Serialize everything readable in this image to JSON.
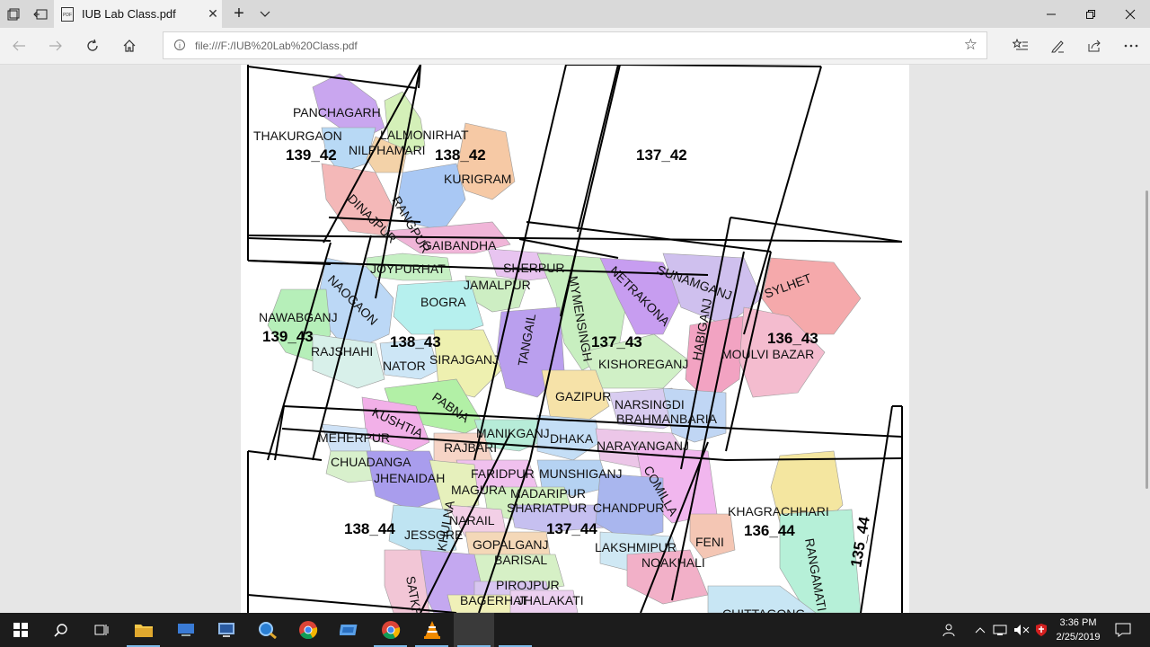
{
  "browser": {
    "tab_title": "IUB Lab Class.pdf",
    "url": "file:///F:/IUB%20Lab%20Class.pdf",
    "new_tab": "+",
    "close_tab": "✕",
    "pdf_icon": "PDF"
  },
  "map": {
    "districts": [
      {
        "name": "PANCHAGARH",
        "color": "#c9a6ef"
      },
      {
        "name": "THAKURGAON",
        "color": "#b8d9f5"
      },
      {
        "name": "LALMONIRHAT",
        "color": "#d4f0b8"
      },
      {
        "name": "NILPHAMARI",
        "color": "#f3d2a8"
      },
      {
        "name": "KURIGRAM",
        "color": "#f6c9a5"
      },
      {
        "name": "DINAJPUR",
        "color": "#f4b8b8"
      },
      {
        "name": "RANGPUR",
        "color": "#a9c8f4"
      },
      {
        "name": "GAIBANDHA",
        "color": "#f0b5d8"
      },
      {
        "name": "JOYPURHAT",
        "color": "#c6f0c4"
      },
      {
        "name": "NAOGAON",
        "color": "#bcd8f6"
      },
      {
        "name": "SHERPUR",
        "color": "#e8c4f0"
      },
      {
        "name": "JAMALPUR",
        "color": "#cdeec3"
      },
      {
        "name": "MYMENSINGH",
        "color": "#c8efc0"
      },
      {
        "name": "NETRAKONA",
        "color": "#c79df0"
      },
      {
        "name": "SUNAMGANJ",
        "color": "#cfc0ee"
      },
      {
        "name": "SYLHET",
        "color": "#f5a9ab"
      },
      {
        "name": "NAWABGANJ",
        "color": "#b6efb9"
      },
      {
        "name": "BOGRA",
        "color": "#b6f0ee"
      },
      {
        "name": "RAJSHAHI",
        "color": "#d8f0ea"
      },
      {
        "name": "NATOR",
        "color": "#cde6f6"
      },
      {
        "name": "SIRAJGANJ",
        "color": "#eef0b0"
      },
      {
        "name": "TANGAIL",
        "color": "#ba9fee"
      },
      {
        "name": "KISHOREGANJ",
        "color": "#d0f0c6"
      },
      {
        "name": "HABIGANJ",
        "color": "#f2a3c2"
      },
      {
        "name": "MOULVI BAZAR",
        "color": "#f4bccf"
      },
      {
        "name": "PABNA",
        "color": "#b2f0a6"
      },
      {
        "name": "GAZIPUR",
        "color": "#f6e2a8"
      },
      {
        "name": "NARSINGDI",
        "color": "#d8ccf0"
      },
      {
        "name": "BRAHMANBARIA",
        "color": "#c0d6f4"
      },
      {
        "name": "KUSHTIA",
        "color": "#f2b0e8"
      },
      {
        "name": "MANIKGANJ",
        "color": "#b7ecd8"
      },
      {
        "name": "DHAKA",
        "color": "#c4def6"
      },
      {
        "name": "NARAYANGANJ",
        "color": "#ecc6e8"
      },
      {
        "name": "MEHERPUR",
        "color": "#cfe2f6"
      },
      {
        "name": "RAJBARI",
        "color": "#f6d4c6"
      },
      {
        "name": "CHUADANGA",
        "color": "#d8f0cc"
      },
      {
        "name": "FARIDPUR",
        "color": "#f0c0ee"
      },
      {
        "name": "MUNSHIGANJ",
        "color": "#b5d2f2"
      },
      {
        "name": "COMILLA",
        "color": "#f1b6ee"
      },
      {
        "name": "JHENAIDAH",
        "color": "#a99ded"
      },
      {
        "name": "MAGURA",
        "color": "#e6f0bc"
      },
      {
        "name": "MADARIPUR",
        "color": "#d2f0c0"
      },
      {
        "name": "SHARIATPUR",
        "color": "#c6c0f0"
      },
      {
        "name": "CHANDPUR",
        "color": "#a9b6ee"
      },
      {
        "name": "KHAGRACHHARI",
        "color": "#f4e6a0"
      },
      {
        "name": "NARAIL",
        "color": "#f2cfe6"
      },
      {
        "name": "JESSORE",
        "color": "#bfe4f2"
      },
      {
        "name": "GOPALGANJ",
        "color": "#f4d8b8"
      },
      {
        "name": "LAKSHMIPUR",
        "color": "#cfe8f4"
      },
      {
        "name": "FENI",
        "color": "#f4c6b4"
      },
      {
        "name": "NOAKHALI",
        "color": "#f2b0c8"
      },
      {
        "name": "BARISAL",
        "color": "#d6f0c6"
      },
      {
        "name": "RANGAMATI",
        "color": "#b6f0d8"
      },
      {
        "name": "KHULNA",
        "color": "#c4a8f0"
      },
      {
        "name": "SATKHIRA",
        "color": "#f2c6d6"
      },
      {
        "name": "PIROJPUR",
        "color": "#d8c6f0"
      },
      {
        "name": "BAGERHAT",
        "color": "#f0f0b8"
      },
      {
        "name": "JHALAKATI",
        "color": "#ecd0f0"
      },
      {
        "name": "CHITTAGONG",
        "color": "#c8e6f4"
      }
    ],
    "grid_labels": [
      "139_42",
      "138_42",
      "137_42",
      "139_43",
      "138_43",
      "137_43",
      "136_43",
      "138_44",
      "137_44",
      "136_44",
      "135_44"
    ]
  },
  "taskbar": {
    "apps": [
      "file-explorer-icon",
      "computer-icon",
      "remote-desktop-icon",
      "search-app-icon",
      "chrome-icon",
      "mail-app-icon",
      "chrome-icon",
      "vlc-icon",
      "active-app-icon",
      "app-icon"
    ],
    "time": "3:36 PM",
    "date": "2/25/2019"
  }
}
